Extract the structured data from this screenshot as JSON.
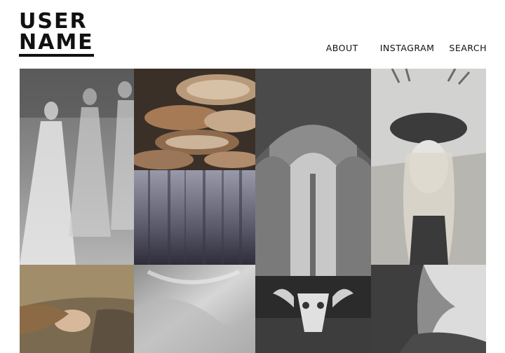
{
  "logo": {
    "line1": "USER",
    "line2": "NAME"
  },
  "nav": {
    "about": "ABOUT",
    "instagram": "INSTAGRAM",
    "search": "SEARCH"
  },
  "gallery": {
    "tiles": [
      "photo-three-women-in-gowns",
      "photo-bracket-fungus",
      "photo-gothic-cathedral-arches",
      "photo-woman-antler-crown",
      "photo-misty-forest",
      "photo-woman-lying-in-grass",
      "photo-sequined-fabric",
      "photo-ram-skull",
      "photo-figure-in-mist"
    ]
  }
}
